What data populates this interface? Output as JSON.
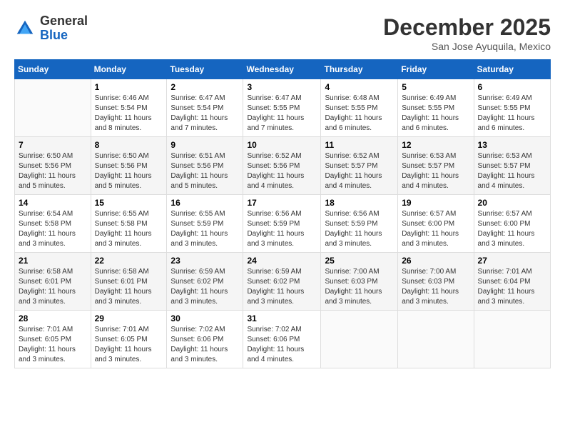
{
  "header": {
    "logo_line1": "General",
    "logo_line2": "Blue",
    "month": "December 2025",
    "location": "San Jose Ayuquila, Mexico"
  },
  "weekdays": [
    "Sunday",
    "Monday",
    "Tuesday",
    "Wednesday",
    "Thursday",
    "Friday",
    "Saturday"
  ],
  "weeks": [
    [
      {
        "day": "",
        "sunrise": "",
        "sunset": "",
        "daylight": ""
      },
      {
        "day": "1",
        "sunrise": "Sunrise: 6:46 AM",
        "sunset": "Sunset: 5:54 PM",
        "daylight": "Daylight: 11 hours and 8 minutes."
      },
      {
        "day": "2",
        "sunrise": "Sunrise: 6:47 AM",
        "sunset": "Sunset: 5:54 PM",
        "daylight": "Daylight: 11 hours and 7 minutes."
      },
      {
        "day": "3",
        "sunrise": "Sunrise: 6:47 AM",
        "sunset": "Sunset: 5:55 PM",
        "daylight": "Daylight: 11 hours and 7 minutes."
      },
      {
        "day": "4",
        "sunrise": "Sunrise: 6:48 AM",
        "sunset": "Sunset: 5:55 PM",
        "daylight": "Daylight: 11 hours and 6 minutes."
      },
      {
        "day": "5",
        "sunrise": "Sunrise: 6:49 AM",
        "sunset": "Sunset: 5:55 PM",
        "daylight": "Daylight: 11 hours and 6 minutes."
      },
      {
        "day": "6",
        "sunrise": "Sunrise: 6:49 AM",
        "sunset": "Sunset: 5:55 PM",
        "daylight": "Daylight: 11 hours and 6 minutes."
      }
    ],
    [
      {
        "day": "7",
        "sunrise": "Sunrise: 6:50 AM",
        "sunset": "Sunset: 5:56 PM",
        "daylight": "Daylight: 11 hours and 5 minutes."
      },
      {
        "day": "8",
        "sunrise": "Sunrise: 6:50 AM",
        "sunset": "Sunset: 5:56 PM",
        "daylight": "Daylight: 11 hours and 5 minutes."
      },
      {
        "day": "9",
        "sunrise": "Sunrise: 6:51 AM",
        "sunset": "Sunset: 5:56 PM",
        "daylight": "Daylight: 11 hours and 5 minutes."
      },
      {
        "day": "10",
        "sunrise": "Sunrise: 6:52 AM",
        "sunset": "Sunset: 5:56 PM",
        "daylight": "Daylight: 11 hours and 4 minutes."
      },
      {
        "day": "11",
        "sunrise": "Sunrise: 6:52 AM",
        "sunset": "Sunset: 5:57 PM",
        "daylight": "Daylight: 11 hours and 4 minutes."
      },
      {
        "day": "12",
        "sunrise": "Sunrise: 6:53 AM",
        "sunset": "Sunset: 5:57 PM",
        "daylight": "Daylight: 11 hours and 4 minutes."
      },
      {
        "day": "13",
        "sunrise": "Sunrise: 6:53 AM",
        "sunset": "Sunset: 5:57 PM",
        "daylight": "Daylight: 11 hours and 4 minutes."
      }
    ],
    [
      {
        "day": "14",
        "sunrise": "Sunrise: 6:54 AM",
        "sunset": "Sunset: 5:58 PM",
        "daylight": "Daylight: 11 hours and 3 minutes."
      },
      {
        "day": "15",
        "sunrise": "Sunrise: 6:55 AM",
        "sunset": "Sunset: 5:58 PM",
        "daylight": "Daylight: 11 hours and 3 minutes."
      },
      {
        "day": "16",
        "sunrise": "Sunrise: 6:55 AM",
        "sunset": "Sunset: 5:59 PM",
        "daylight": "Daylight: 11 hours and 3 minutes."
      },
      {
        "day": "17",
        "sunrise": "Sunrise: 6:56 AM",
        "sunset": "Sunset: 5:59 PM",
        "daylight": "Daylight: 11 hours and 3 minutes."
      },
      {
        "day": "18",
        "sunrise": "Sunrise: 6:56 AM",
        "sunset": "Sunset: 5:59 PM",
        "daylight": "Daylight: 11 hours and 3 minutes."
      },
      {
        "day": "19",
        "sunrise": "Sunrise: 6:57 AM",
        "sunset": "Sunset: 6:00 PM",
        "daylight": "Daylight: 11 hours and 3 minutes."
      },
      {
        "day": "20",
        "sunrise": "Sunrise: 6:57 AM",
        "sunset": "Sunset: 6:00 PM",
        "daylight": "Daylight: 11 hours and 3 minutes."
      }
    ],
    [
      {
        "day": "21",
        "sunrise": "Sunrise: 6:58 AM",
        "sunset": "Sunset: 6:01 PM",
        "daylight": "Daylight: 11 hours and 3 minutes."
      },
      {
        "day": "22",
        "sunrise": "Sunrise: 6:58 AM",
        "sunset": "Sunset: 6:01 PM",
        "daylight": "Daylight: 11 hours and 3 minutes."
      },
      {
        "day": "23",
        "sunrise": "Sunrise: 6:59 AM",
        "sunset": "Sunset: 6:02 PM",
        "daylight": "Daylight: 11 hours and 3 minutes."
      },
      {
        "day": "24",
        "sunrise": "Sunrise: 6:59 AM",
        "sunset": "Sunset: 6:02 PM",
        "daylight": "Daylight: 11 hours and 3 minutes."
      },
      {
        "day": "25",
        "sunrise": "Sunrise: 7:00 AM",
        "sunset": "Sunset: 6:03 PM",
        "daylight": "Daylight: 11 hours and 3 minutes."
      },
      {
        "day": "26",
        "sunrise": "Sunrise: 7:00 AM",
        "sunset": "Sunset: 6:03 PM",
        "daylight": "Daylight: 11 hours and 3 minutes."
      },
      {
        "day": "27",
        "sunrise": "Sunrise: 7:01 AM",
        "sunset": "Sunset: 6:04 PM",
        "daylight": "Daylight: 11 hours and 3 minutes."
      }
    ],
    [
      {
        "day": "28",
        "sunrise": "Sunrise: 7:01 AM",
        "sunset": "Sunset: 6:05 PM",
        "daylight": "Daylight: 11 hours and 3 minutes."
      },
      {
        "day": "29",
        "sunrise": "Sunrise: 7:01 AM",
        "sunset": "Sunset: 6:05 PM",
        "daylight": "Daylight: 11 hours and 3 minutes."
      },
      {
        "day": "30",
        "sunrise": "Sunrise: 7:02 AM",
        "sunset": "Sunset: 6:06 PM",
        "daylight": "Daylight: 11 hours and 3 minutes."
      },
      {
        "day": "31",
        "sunrise": "Sunrise: 7:02 AM",
        "sunset": "Sunset: 6:06 PM",
        "daylight": "Daylight: 11 hours and 4 minutes."
      },
      {
        "day": "",
        "sunrise": "",
        "sunset": "",
        "daylight": ""
      },
      {
        "day": "",
        "sunrise": "",
        "sunset": "",
        "daylight": ""
      },
      {
        "day": "",
        "sunrise": "",
        "sunset": "",
        "daylight": ""
      }
    ]
  ]
}
